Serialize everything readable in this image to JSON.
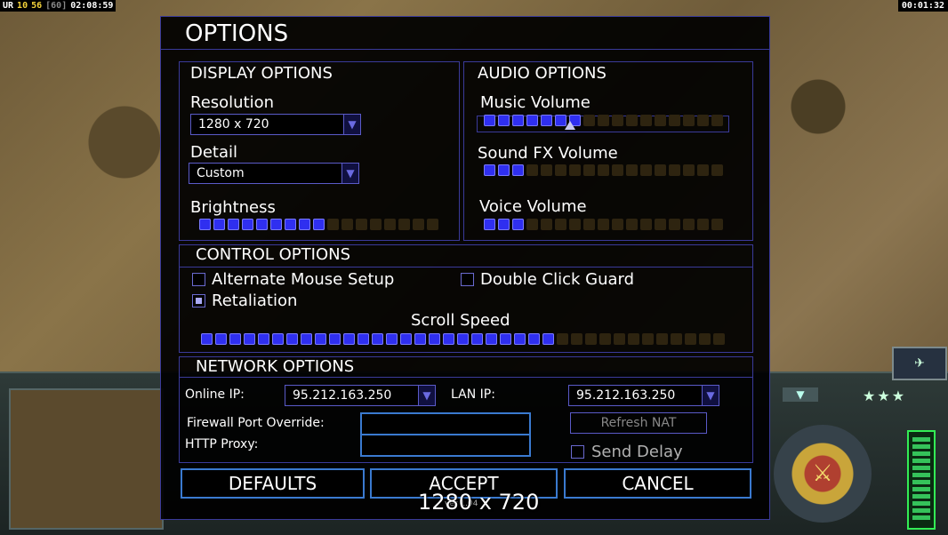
{
  "hud": {
    "left": {
      "a": "UR",
      "b": "10",
      "c": "56",
      "d": "[60]",
      "time": "02:08:59"
    },
    "right_time": "00:01:32"
  },
  "dialog": {
    "title": "OPTIONS",
    "display": {
      "title": "DISPLAY OPTIONS",
      "resolution_label": "Resolution",
      "resolution_value": "1280 x 720",
      "detail_label": "Detail",
      "detail_value": "Custom",
      "brightness_label": "Brightness",
      "brightness_level": 9,
      "brightness_max": 17
    },
    "audio": {
      "title": "AUDIO OPTIONS",
      "music_label": "Music Volume",
      "music_level": 7,
      "music_max": 17,
      "sfx_label": "Sound FX Volume",
      "sfx_level": 3,
      "sfx_max": 17,
      "voice_label": "Voice Volume",
      "voice_level": 3,
      "voice_max": 17
    },
    "control": {
      "title": "CONTROL OPTIONS",
      "alt_mouse_label": "Alternate Mouse Setup",
      "alt_mouse_checked": false,
      "double_click_label": "Double Click Guard",
      "double_click_checked": false,
      "retaliation_label": "Retaliation",
      "retaliation_checked": true,
      "scroll_label": "Scroll Speed",
      "scroll_level": 25,
      "scroll_max": 37
    },
    "network": {
      "title": "NETWORK OPTIONS",
      "online_ip_label": "Online IP:",
      "online_ip_value": "95.212.163.250",
      "lan_ip_label": "LAN IP:",
      "lan_ip_value": "95.212.163.250",
      "firewall_label": "Firewall Port Override:",
      "firewall_value": "",
      "http_proxy_label": "HTTP Proxy:",
      "http_proxy_value": "",
      "refresh_nat_label": "Refresh NAT",
      "send_delay_label": "Send Delay",
      "send_delay_checked": false
    },
    "buttons": {
      "defaults": "DEFAULTS",
      "accept": "ACCEPT",
      "cancel": "CANCEL"
    },
    "overlay_resolution": "1280 x 720",
    "version_text": "ver 1.04"
  },
  "colors": {
    "accent": "#3a3a9a",
    "slider_on": "#2f2ff0",
    "slider_off": "#2e2410",
    "button_border": "#3a7ad0"
  }
}
